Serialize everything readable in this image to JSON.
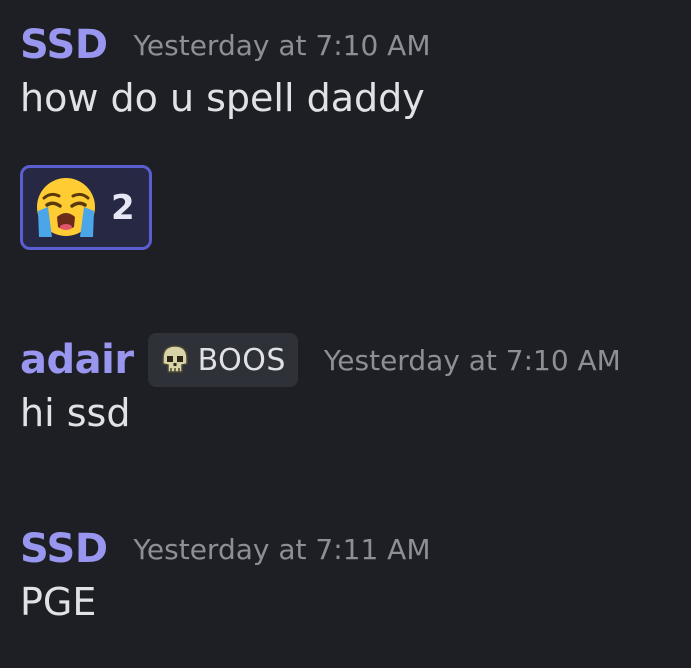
{
  "messages": [
    {
      "author": "SSD",
      "timestamp": "Yesterday at 7:10 AM",
      "text": "how do u spell daddy",
      "reaction": {
        "emoji": "loudly-crying-face",
        "count": "2"
      }
    },
    {
      "author": "adair",
      "tag": {
        "icon": "skull-icon",
        "text": "BOOS"
      },
      "timestamp": "Yesterday at 7:10 AM",
      "text": "hi ssd"
    },
    {
      "author": "SSD",
      "timestamp": "Yesterday at 7:11 AM",
      "text": "PGE"
    }
  ],
  "colors": {
    "background": "#1e1f24",
    "author": "#9896ee",
    "timestamp": "#8d8f97",
    "reaction_border": "#5a5ed1",
    "reaction_bg": "#262844"
  }
}
